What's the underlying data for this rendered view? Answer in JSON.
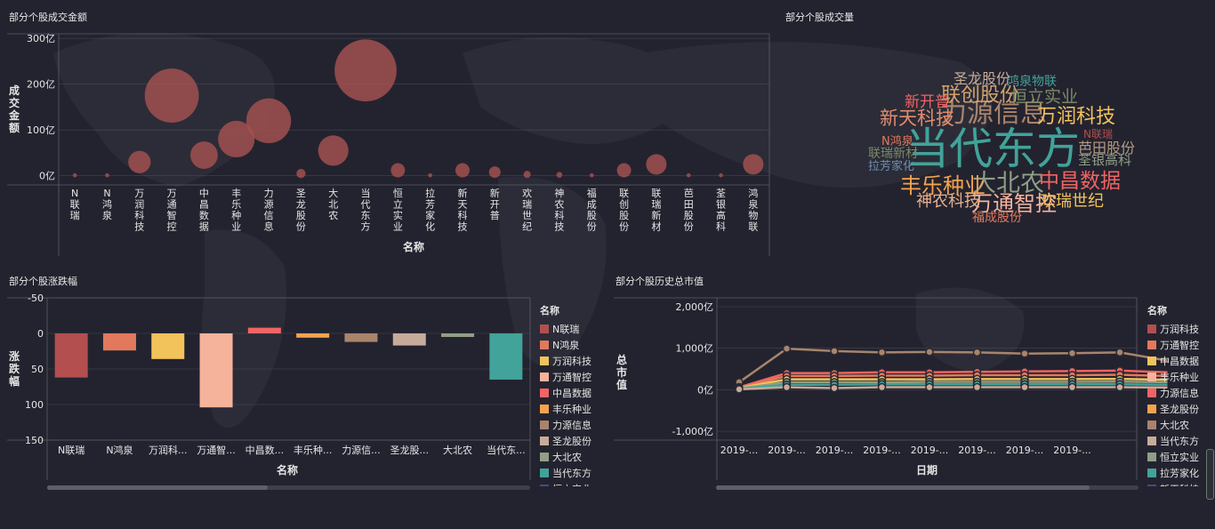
{
  "colors": {
    "bubble": "#a1504f",
    "grid": "#5b5e6a",
    "axis_text": "#e6e6e6",
    "palette": [
      "#b34f4f",
      "#e2795c",
      "#f3c35b",
      "#f6b39b",
      "#f06463",
      "#f5a24e",
      "#a9846b",
      "#c7ab9a",
      "#8f9f85",
      "#41a39a",
      "#3b4f8a",
      "#e9b18f",
      "#9cb9c1",
      "#d2a36d",
      "#a26a56",
      "#69bdb1",
      "#e38b6e",
      "#cf6a6a",
      "#7b8a68",
      "#b49a80",
      "#6e8fb5",
      "#d8c27a"
    ]
  },
  "panels": {
    "amount": {
      "title": "部分个股成交金额"
    },
    "volume": {
      "title": "部分个股成交量"
    },
    "change": {
      "title": "部分个股涨跌幅"
    },
    "market": {
      "title": "部分个股历史总市值"
    }
  },
  "chart_data": [
    {
      "type": "scatter",
      "title": "部分个股成交金额",
      "xlabel": "名称",
      "ylabel": "成交金额",
      "categories": [
        "N联瑞",
        "N鸿泉",
        "万润科技",
        "万通智控",
        "中昌数据",
        "丰乐种业",
        "力源信息",
        "圣龙股份",
        "大北农",
        "当代东方",
        "恒立实业",
        "拉芳家化",
        "新天科技",
        "新开普",
        "欢瑞世纪",
        "神农科技",
        "福成股份",
        "联创股份",
        "联瑞新材",
        "芭田股份",
        "荃银高科",
        "鸿泉物联"
      ],
      "values": [
        1,
        1,
        30,
        175,
        45,
        80,
        120,
        5,
        55,
        230,
        12,
        1,
        12,
        8,
        3,
        2,
        1,
        12,
        25,
        1,
        1,
        25
      ],
      "ytick_labels": [
        "300亿",
        "200亿",
        "100亿",
        "0亿"
      ],
      "ylim": [
        -20,
        310
      ]
    },
    {
      "type": "wordcloud",
      "title": "部分个股成交量",
      "words": [
        {
          "text": "当代东方",
          "weight": 100,
          "color": "#41a39a"
        },
        {
          "text": "力源信息",
          "weight": 55,
          "color": "#a9846b"
        },
        {
          "text": "大北农",
          "weight": 48,
          "color": "#8f9f85"
        },
        {
          "text": "丰乐种业",
          "weight": 40,
          "color": "#f5a24e"
        },
        {
          "text": "万通智控",
          "weight": 40,
          "color": "#f6b39b"
        },
        {
          "text": "中昌数据",
          "weight": 38,
          "color": "#f06463"
        },
        {
          "text": "万润科技",
          "weight": 36,
          "color": "#f3c35b"
        },
        {
          "text": "联创股份",
          "weight": 36,
          "color": "#d2a36d"
        },
        {
          "text": "新天科技",
          "weight": 33,
          "color": "#e38b6e"
        },
        {
          "text": "恒立实业",
          "weight": 28,
          "color": "#7b8a68"
        },
        {
          "text": "神农科技",
          "weight": 26,
          "color": "#e9b18f"
        },
        {
          "text": "欢瑞世纪",
          "weight": 26,
          "color": "#f3c35b"
        },
        {
          "text": "新开普",
          "weight": 24,
          "color": "#f06463"
        },
        {
          "text": "芭田股份",
          "weight": 22,
          "color": "#b49a80"
        },
        {
          "text": "圣龙股份",
          "weight": 22,
          "color": "#c7ab9a"
        },
        {
          "text": "荃银高科",
          "weight": 18,
          "color": "#8f9f85"
        },
        {
          "text": "鸿泉物联",
          "weight": 17,
          "color": "#41a39a"
        },
        {
          "text": "福成股份",
          "weight": 17,
          "color": "#e2795c"
        },
        {
          "text": "联瑞新材",
          "weight": 16,
          "color": "#7b8a68"
        },
        {
          "text": "拉芳家化",
          "weight": 15,
          "color": "#6e8fb5"
        },
        {
          "text": "N鸿泉",
          "weight": 14,
          "color": "#e2795c"
        },
        {
          "text": "N联瑞",
          "weight": 13,
          "color": "#b34f4f"
        }
      ]
    },
    {
      "type": "bar",
      "title": "部分个股涨跌幅",
      "xlabel": "名称",
      "ylabel": "涨跌幅",
      "categories": [
        "N联瑞",
        "N鸿泉",
        "万润科技",
        "万通智控",
        "中昌数据",
        "丰乐种业",
        "力源信息",
        "圣龙股份",
        "大北农",
        "当代东方"
      ],
      "tick_labels": [
        "N联瑞",
        "N鸿泉",
        "万润科...",
        "万通智...",
        "中昌数...",
        "丰乐种...",
        "力源信...",
        "圣龙股...",
        "大北农",
        "当代东..."
      ],
      "values": [
        62,
        24,
        36,
        104,
        -8,
        6,
        12,
        17,
        5,
        65
      ],
      "ytick_labels": [
        "-50",
        "0",
        "50",
        "100",
        "150"
      ],
      "ylim": [
        -50,
        150
      ],
      "legend_title": "名称",
      "legend": [
        "N联瑞",
        "N鸿泉",
        "万润科技",
        "万通智控",
        "中昌数据",
        "丰乐种业",
        "力源信息",
        "圣龙股份",
        "大北农",
        "当代东方",
        "恒立实业"
      ]
    },
    {
      "type": "line",
      "title": "部分个股历史总市值",
      "xlabel": "日期",
      "ylabel": "总市值",
      "x_labels": [
        "2019-...",
        "2019-...",
        "2019-...",
        "2019-...",
        "2019-...",
        "2019-...",
        "2019-...",
        "2019-..."
      ],
      "ytick_labels": [
        "2,000亿",
        "1,000亿",
        "0亿",
        "-1,000亿"
      ],
      "ylim": [
        -1000,
        2000
      ],
      "legend_title": "名称",
      "legend": [
        "万润科技",
        "万通智控",
        "中昌数据",
        "丰乐种业",
        "力源信息",
        "圣龙股份",
        "大北农",
        "当代东方",
        "恒立实业",
        "拉芳家化",
        "新天科技"
      ],
      "series": [
        {
          "name": "大北农",
          "values": [
            180,
            990,
            930,
            900,
            910,
            900,
            870,
            880,
            900,
            700
          ]
        },
        {
          "name": "力源信息",
          "values": [
            60,
            400,
            400,
            420,
            420,
            430,
            440,
            450,
            460,
            420
          ]
        },
        {
          "name": "万通智控",
          "values": [
            50,
            330,
            330,
            340,
            340,
            350,
            350,
            350,
            360,
            330
          ]
        },
        {
          "name": "万润科技",
          "values": [
            40,
            250,
            250,
            250,
            250,
            255,
            255,
            255,
            260,
            240
          ]
        },
        {
          "name": "恒立实业",
          "values": [
            30,
            180,
            180,
            180,
            190,
            190,
            190,
            190,
            195,
            180
          ]
        },
        {
          "name": "拉芳家化",
          "values": [
            20,
            120,
            120,
            130,
            130,
            130,
            130,
            130,
            130,
            120
          ]
        },
        {
          "name": "当代东方",
          "values": [
            10,
            60,
            40,
            60,
            60,
            60,
            60,
            60,
            60,
            55
          ]
        }
      ]
    }
  ]
}
